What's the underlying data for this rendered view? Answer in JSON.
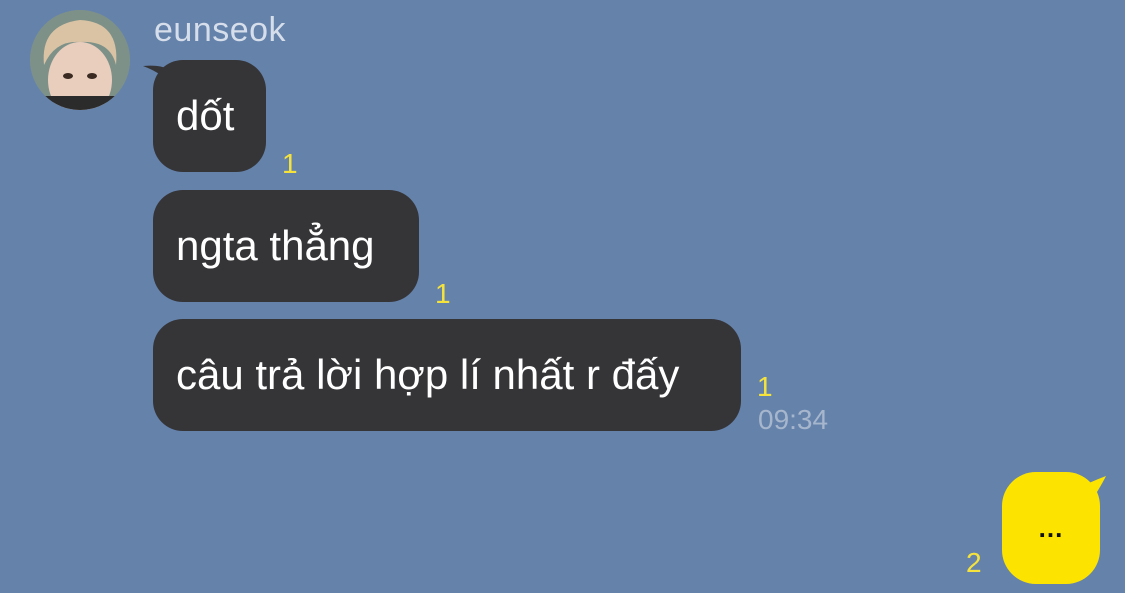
{
  "chat": {
    "sender": {
      "name": "eunseok",
      "avatar_icon": "user-avatar-photo"
    },
    "messages": [
      {
        "text": "dốt",
        "read_count": "1"
      },
      {
        "text": "ngta thẳng",
        "read_count": "1"
      },
      {
        "text": "câu trả lời hợp lí nhất r đấy",
        "read_count": "1",
        "time": "09:34"
      }
    ],
    "my_message": {
      "text": "...",
      "read_count": "2"
    }
  },
  "colors": {
    "background": "#6582ab",
    "incoming_bubble": "#353538",
    "outgoing_bubble": "#fde400",
    "unread_count": "#f5e33c",
    "timestamp": "#a6b6cc"
  }
}
